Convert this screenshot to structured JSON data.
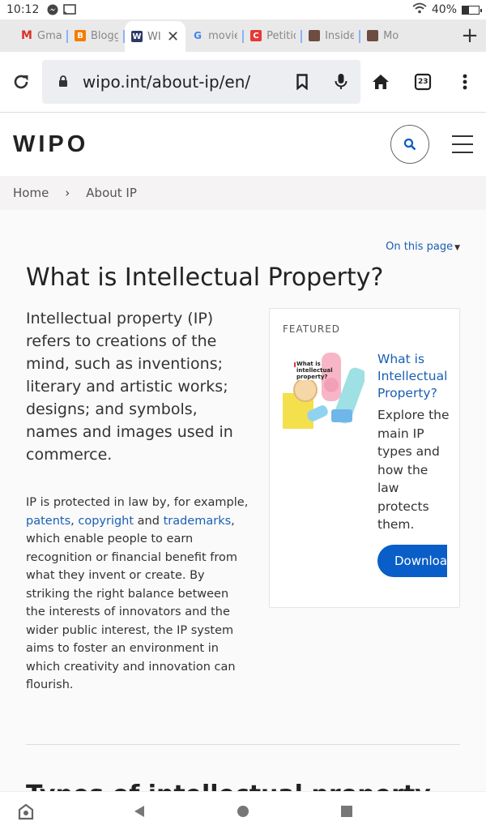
{
  "status": {
    "time": "10:12",
    "battery": "40%"
  },
  "tabs": [
    {
      "label": "Gmail",
      "favicon_color": "#d93025",
      "favicon_text": "M"
    },
    {
      "label": "Blogger",
      "favicon_color": "#f57c00",
      "favicon_text": "B"
    },
    {
      "label": "WIPO",
      "favicon_color": "#2b3a67",
      "favicon_text": "W",
      "active": true
    },
    {
      "label": "movie",
      "favicon_color": "#4285f4",
      "favicon_text": "G"
    },
    {
      "label": "Petition",
      "favicon_color": "#e53935",
      "favicon_text": "C"
    },
    {
      "label": "Insider",
      "favicon_color": "#6d4c41",
      "favicon_text": ""
    },
    {
      "label": "Movie",
      "favicon_color": "#6d4c41",
      "favicon_text": ""
    }
  ],
  "toolbar": {
    "url": "wipo.int/about-ip/en/",
    "tab_count": "23"
  },
  "site": {
    "logo": "WIPO"
  },
  "breadcrumb": {
    "home": "Home",
    "current": "About IP"
  },
  "page": {
    "on_this_page": "On this page",
    "title": "What is Intellectual Property?",
    "lead": "Intellectual property (IP) refers to creations of the mind, such as inventions; literary and artistic works; designs; and symbols, names and images used in commerce.",
    "body_pre": "IP is protected in law by, for example, ",
    "link_patents": "patents",
    "sep1": ", ",
    "link_copyright": "copyright",
    "sep2": " and ",
    "link_trademarks": "trademarks",
    "body_post": ", which enable people to earn recognition or financial benefit from what they invent or create. By striking the right balance between the interests of innovators and the wider public interest, the IP system aims to foster an environment in which creativity and innovation can flourish.",
    "next_heading": "Types of intellectual property"
  },
  "featured": {
    "label": "FEATURED",
    "thumb_text": "What is intellectual property?",
    "title": "What is Intellectual Property?",
    "description": "Explore the main IP types and how the law protects them.",
    "button": "Download"
  },
  "colors": {
    "link": "#1a5fb4",
    "button": "#0a5ec7"
  }
}
